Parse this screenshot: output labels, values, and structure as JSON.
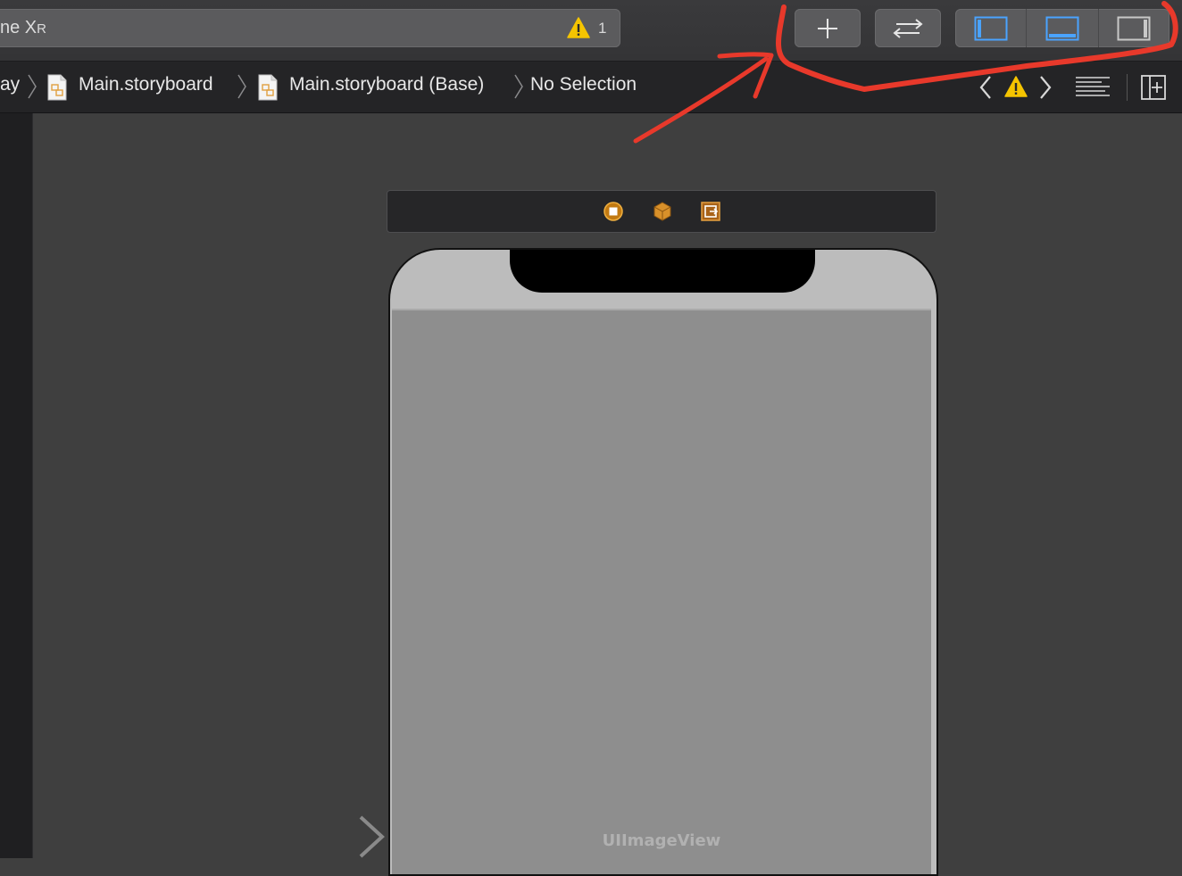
{
  "toolbar": {
    "scheme_destination": "ne X",
    "scheme_suffix": "R",
    "warning_count": "1",
    "buttons": [
      {
        "name": "library-button",
        "icon": "plus-icon"
      },
      {
        "name": "code-review-button",
        "icon": "swap-arrows-icon"
      }
    ],
    "panel_toggles": [
      {
        "name": "navigator-toggle",
        "icon": "left-panel-icon",
        "active": true
      },
      {
        "name": "debug-area-toggle",
        "icon": "bottom-panel-icon",
        "active": true
      },
      {
        "name": "inspector-toggle",
        "icon": "right-panel-icon",
        "active": false
      }
    ]
  },
  "jumpbar": {
    "crumbs": [
      "ay",
      "Main.storyboard",
      "Main.storyboard (Base)",
      "No Selection"
    ]
  },
  "canvas": {
    "imageview_label": "UIImageView"
  },
  "colors": {
    "accent": "#4aa3ff",
    "warning": "#f5c400",
    "annotation": "#e8392b",
    "scene_icon": "#e0a040"
  }
}
